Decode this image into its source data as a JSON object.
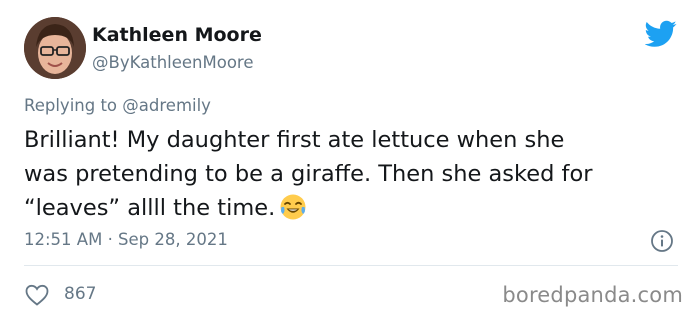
{
  "tweet": {
    "author": {
      "display_name": "Kathleen Moore",
      "handle": "@ByKathleenMoore",
      "avatar_icon": "user-avatar"
    },
    "reply_to": {
      "prefix": "Replying to",
      "handle": "@adremily"
    },
    "text_line1": "Brilliant! My daughter first ate lettuce when she",
    "text_line2": "was pretending to be a giraffe. Then she asked for",
    "text_line3": "“leaves” allll the time.",
    "emoji": "face-with-tears-of-joy",
    "timestamp": "12:51 AM · Sep 28, 2021",
    "likes": "867"
  },
  "icons": {
    "platform": "twitter-bird-icon",
    "info": "info-icon",
    "like": "heart-icon"
  },
  "colors": {
    "brand_blue": "#1da1f2",
    "secondary_text": "#657786",
    "divider": "#e1e8ed"
  },
  "watermark": "boredpanda.com"
}
